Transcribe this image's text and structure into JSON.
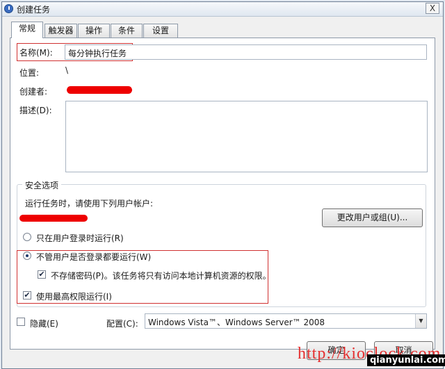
{
  "window": {
    "title": "创建任务",
    "close_glyph": "X"
  },
  "tabs": [
    {
      "label": "常规",
      "active": true
    },
    {
      "label": "触发器",
      "active": false
    },
    {
      "label": "操作",
      "active": false
    },
    {
      "label": "条件",
      "active": false
    },
    {
      "label": "设置",
      "active": false
    }
  ],
  "general": {
    "name_label": "名称(M):",
    "name_value": "每分钟执行任务",
    "location_label": "位置:",
    "location_value": "\\",
    "author_label": "创建者:",
    "description_label": "描述(D):",
    "description_value": ""
  },
  "security": {
    "group_title": "安全选项",
    "run_as_prompt": "运行任务时，请使用下列用户帐户:",
    "change_user_button": "更改用户或组(U)...",
    "option_logged_on": "只在用户登录时运行(R)",
    "option_logged_on_selected": false,
    "option_any": "不管用户是否登录都要运行(W)",
    "option_any_selected": true,
    "no_store_password": "不存储密码(P)。该任务将只有访问本地计算机资源的权限。",
    "no_store_password_checked": true,
    "highest_privileges": "使用最高权限运行(I)",
    "highest_privileges_checked": true
  },
  "footer": {
    "hidden_label": "隐藏(E)",
    "hidden_checked": false,
    "config_label": "配置(C):",
    "config_value": "Windows Vista™、Windows Server™ 2008",
    "ok_button": "确定",
    "cancel_button": "取消"
  },
  "watermarks": {
    "red_text": "http://kioclock.com",
    "black_text": "qianyunlai.com"
  },
  "colors": {
    "window_bg": "#f0f0f0",
    "panel_bg": "#ffffff",
    "highlight_box": "#d03030",
    "redaction": "#ee0000"
  }
}
